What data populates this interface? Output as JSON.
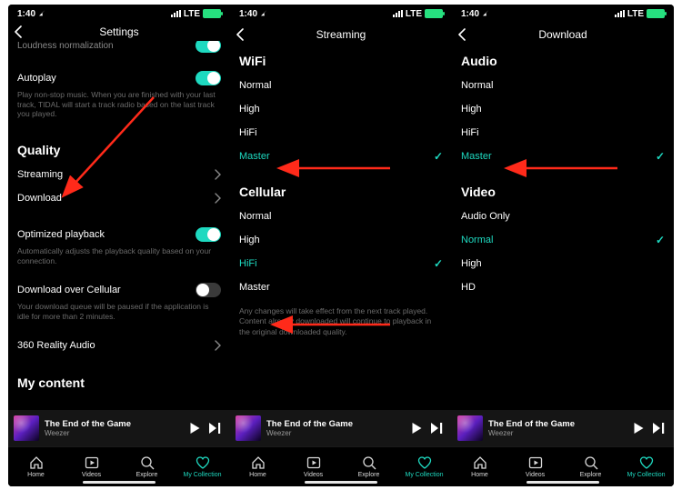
{
  "status": {
    "time": "1:40",
    "carrier_label": "LTE"
  },
  "accent": "#1ed9c0",
  "arrow_color": "#ff2a1a",
  "panel1": {
    "header_title": "Settings",
    "loudness": {
      "label": "Loudness normalization",
      "on": true
    },
    "autoplay": {
      "label": "Autoplay",
      "on": true,
      "desc": "Play non-stop music. When you are finished with your last track, TIDAL will start a track radio based on the last track you played."
    },
    "quality_title": "Quality",
    "streaming_label": "Streaming",
    "download_label": "Download",
    "optimized": {
      "label": "Optimized playback",
      "on": true,
      "desc": "Automatically adjusts the playback quality based on your connection."
    },
    "dl_cell": {
      "label": "Download over Cellular",
      "on": false,
      "desc": "Your download queue will be paused if the application is idle for more than 2 minutes."
    },
    "reality_label": "360 Reality Audio",
    "mycontent_title": "My content"
  },
  "panel2": {
    "header_title": "Streaming",
    "wifi_title": "WiFi",
    "wifi_options": [
      {
        "label": "Normal",
        "selected": false
      },
      {
        "label": "High",
        "selected": false
      },
      {
        "label": "HiFi",
        "selected": false
      },
      {
        "label": "Master",
        "selected": true
      }
    ],
    "cell_title": "Cellular",
    "cell_options": [
      {
        "label": "Normal",
        "selected": false
      },
      {
        "label": "High",
        "selected": false
      },
      {
        "label": "HiFi",
        "selected": true
      },
      {
        "label": "Master",
        "selected": false
      }
    ],
    "footnote": "Any changes will take effect from the next track played. Content already downloaded will continue to playback in the original downloaded quality."
  },
  "panel3": {
    "header_title": "Download",
    "audio_title": "Audio",
    "audio_options": [
      {
        "label": "Normal",
        "selected": false
      },
      {
        "label": "High",
        "selected": false
      },
      {
        "label": "HiFi",
        "selected": false
      },
      {
        "label": "Master",
        "selected": true
      }
    ],
    "video_title": "Video",
    "video_options": [
      {
        "label": "Audio Only",
        "selected": false
      },
      {
        "label": "Normal",
        "selected": true
      },
      {
        "label": "High",
        "selected": false
      },
      {
        "label": "HD",
        "selected": false
      }
    ]
  },
  "nowplaying": {
    "title": "The End of the Game",
    "artist": "Weezer"
  },
  "tabs": {
    "home": "Home",
    "videos": "Videos",
    "explore": "Explore",
    "mycollection": "My Collection"
  }
}
